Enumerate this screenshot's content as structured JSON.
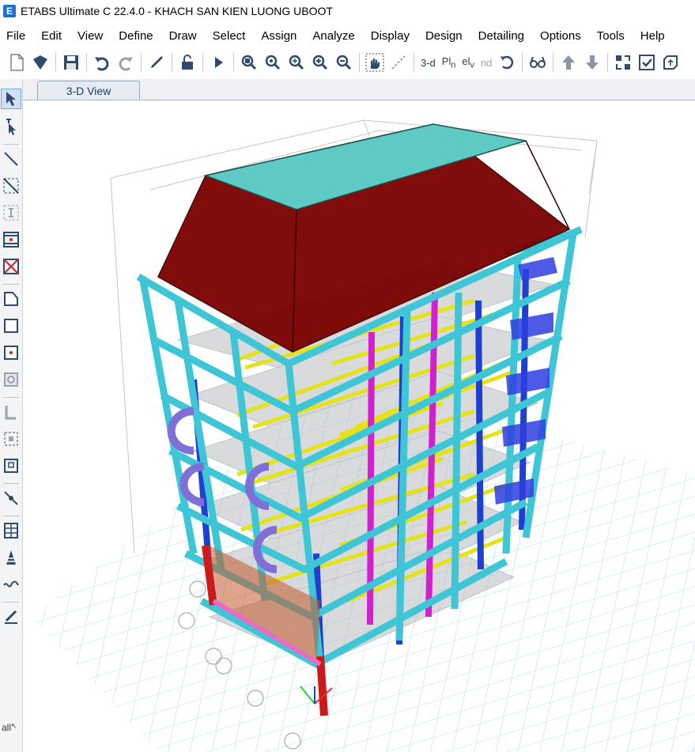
{
  "window": {
    "app_title": "ETABS Ultimate C 22.4.0 - KHACH SAN KIEN LUONG UBOOT",
    "logo_letter": "E"
  },
  "menu": [
    "File",
    "Edit",
    "View",
    "Define",
    "Draw",
    "Select",
    "Assign",
    "Analyze",
    "Display",
    "Design",
    "Detailing",
    "Options",
    "Tools",
    "Help"
  ],
  "toolbar": {
    "view_3d": "3-d",
    "plan": "Pl",
    "plan_sub": "n",
    "elev": "el",
    "elev_sub": "v",
    "nd": "nd"
  },
  "tabs": [
    {
      "label": "3-D View",
      "active": true
    }
  ],
  "sidebar": {
    "all_label": "all"
  },
  "colors": {
    "column": "#3aa8b8",
    "column_outline": "#2b5dbd",
    "beam_highlight": "#e6e21a",
    "roof": "#7a0000",
    "roof_top": "#5fc9c4",
    "accent_magenta": "#d020d0",
    "accent_blue": "#1f3fd0",
    "grid": "#a8d8ee",
    "base_red": "#cc1a1a"
  }
}
